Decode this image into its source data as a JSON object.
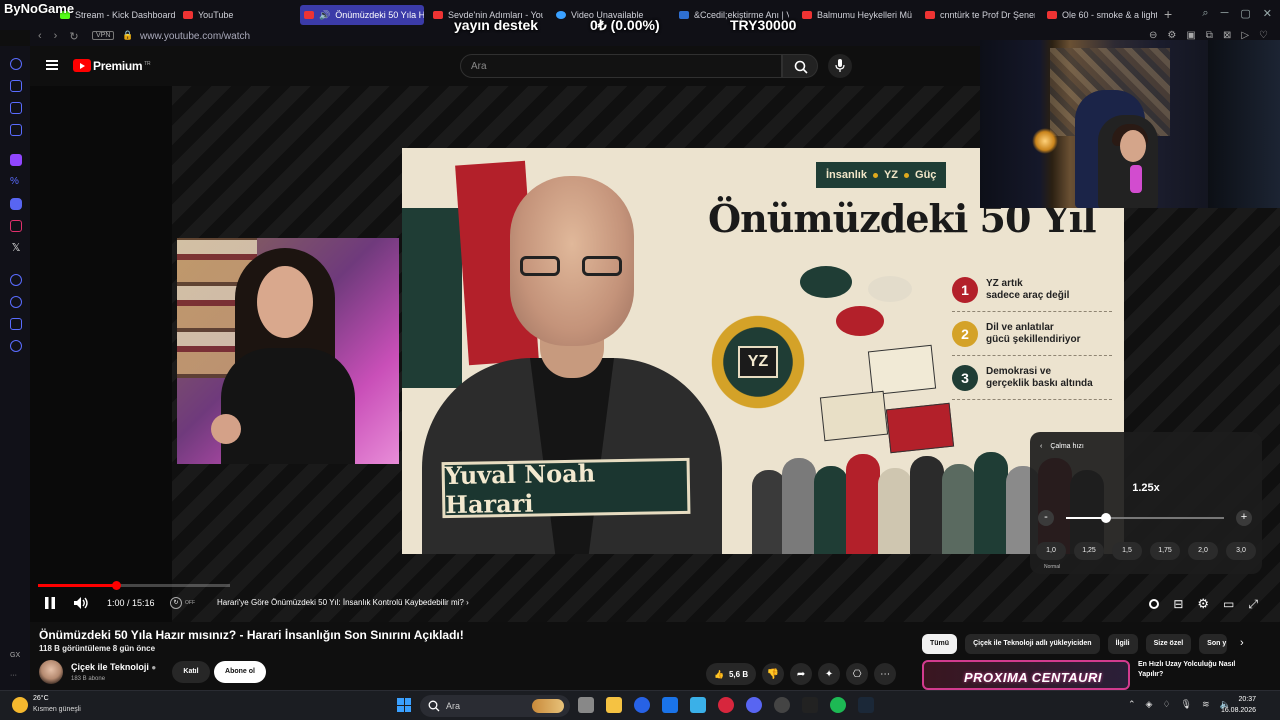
{
  "browser": {
    "brand": "ByNoGame",
    "tabs": [
      {
        "label": "Stream - Kick Dashboard",
        "favicon": "kick-icon"
      },
      {
        "label": "YouTube",
        "favicon": "youtube-icon"
      },
      {
        "label": "Önümüzdeki 50 Yıla Ha",
        "favicon": "youtube-icon",
        "active": true
      },
      {
        "label": "Sevde'nin Adımları - YouT",
        "favicon": "youtube-icon"
      },
      {
        "label": "Video Unavailable",
        "favicon": "info-icon"
      },
      {
        "label": "&Ccedil;ekiştirme Anı | Vi",
        "favicon": "v-icon"
      },
      {
        "label": "Balmumu Heykelleri Müze",
        "favicon": "youtube-icon"
      },
      {
        "label": "cnntürk te Prof Dr Şener",
        "favicon": "youtube-icon"
      },
      {
        "label": "Ole 60 - smoke & a light (",
        "favicon": "youtube-icon"
      }
    ],
    "new_tab": "+",
    "vpn": "VPN",
    "url": "www.youtube.com/watch"
  },
  "overlay": {
    "support": "yayın destek",
    "percent": "0₺ (0.00%)",
    "goal": "TRY30000"
  },
  "youtube": {
    "logo_text": "Premium",
    "logo_sup": "TR",
    "search_placeholder": "Ara"
  },
  "thumbnail": {
    "tags": [
      "İnsanlık",
      "YZ",
      "Güç"
    ],
    "title": "Önümüzdeki 50 Yıl",
    "chip_label": "YZ",
    "name": "Yuval Noah Harari",
    "points": [
      {
        "num": "1",
        "line1": "YZ artık",
        "line2": "sadece araç değil",
        "color": "#b3202a"
      },
      {
        "num": "2",
        "line1": "Dil ve anlatılar",
        "line2": "gücü şekillendiriyor",
        "color": "#d4a228"
      },
      {
        "num": "3",
        "line1": "Demokrasi ve",
        "line2": "gerçeklik baskı altında",
        "color": "#1f3d35"
      }
    ]
  },
  "speed_panel": {
    "title": "Çalma hızı",
    "value": "1.25x",
    "minus": "-",
    "plus": "+",
    "level": 0.25,
    "presets": [
      "1,0",
      "1,25",
      "1,5",
      "1,75",
      "2,0",
      "3,0"
    ],
    "normal_label": "Normal"
  },
  "player": {
    "progress": 0.066,
    "time": "1:00 / 15:16",
    "toggle_off": "OFF",
    "chapter": "Harari'ye Göre Önümüzdeki 50 Yıl: İnsanlık Kontrolü Kaybedebilir mi?"
  },
  "video": {
    "title": "Önümüzdeki 50 Yıla Hazır mısınız? - Harari İnsanlığın Son Sınırını Açıkladı!",
    "stats": "118 B görüntüleme  8 gün önce",
    "channel": "Çiçek ile Teknoloji",
    "subscribers": "183 B abone",
    "join": "Katıl",
    "subscribe": "Abone ol",
    "likes": "5,6 B"
  },
  "chips": [
    "Tümü",
    "Çiçek ile Teknoloji adlı yükleyiciden",
    "İlgili",
    "Size özel",
    "Son y"
  ],
  "recommended": {
    "thumb_text": "PROXIMA CENTAURI",
    "title": "En Hızlı Uzay Yolculuğu Nasıl Yapılır?"
  },
  "taskbar": {
    "temp": "26°C",
    "weather": "Kısmen güneşli",
    "search_placeholder": "Ara",
    "time": "20:37",
    "date": "16.08.2026"
  },
  "sidebar": {
    "gx": "GX",
    "more": "···"
  }
}
